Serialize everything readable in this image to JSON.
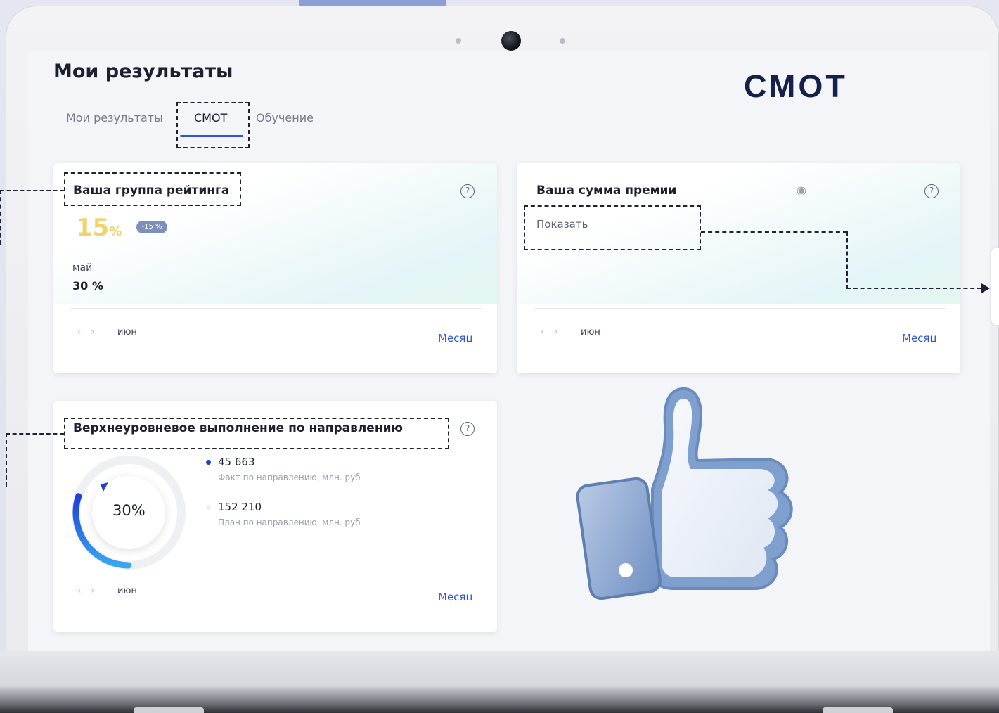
{
  "page": {
    "title": "Мои результаты",
    "brand": "СМОТ"
  },
  "tabs": [
    {
      "label": "Мои результаты",
      "active": false
    },
    {
      "label": "СМОТ",
      "active": true
    },
    {
      "label": "Обучение",
      "active": false
    }
  ],
  "rating_card": {
    "title": "Ваша группа рейтинга",
    "value": "15",
    "unit": "%",
    "badge": "-15 %",
    "prev_label": "май",
    "prev_value": "30 %",
    "period": "июн",
    "period_link": "Месяц",
    "help": "?"
  },
  "bonus_card": {
    "title": "Ваша сумма премии",
    "show_link": "Показать",
    "period": "июн",
    "period_link": "Месяц",
    "help": "?",
    "eye_icon": "eye-icon"
  },
  "exec_card": {
    "title": "Верхнеуровневое выполнение по направлению",
    "percent": "30%",
    "progress": 0.3,
    "fact_value": "45 663",
    "fact_label": "Факт по направлению, млн. руб",
    "plan_value": "152 210",
    "plan_label": "План по направлению, млн. руб",
    "period": "июн",
    "period_link": "Месяц",
    "help": "?"
  },
  "colors": {
    "accent": "#2d56d8",
    "highlight": "#f0d36c",
    "brand": "#16204a",
    "thumb": "#7f9fcf"
  }
}
